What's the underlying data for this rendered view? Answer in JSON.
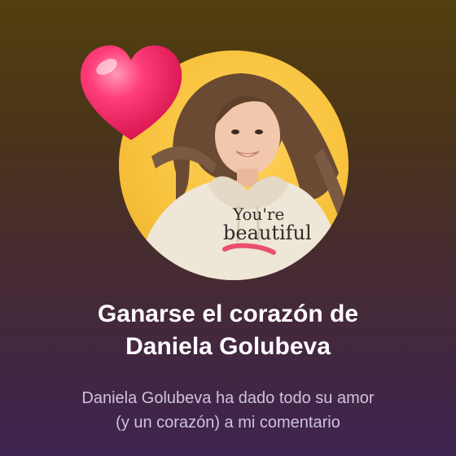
{
  "card": {
    "title_line1": "Ganarse el corazón de",
    "title_line2": "Daniela Golubeva",
    "subtitle_line1": "Daniela Golubeva ha dado todo su amor",
    "subtitle_line2": "(y un corazón) a mi comentario",
    "photo_text_line1": "You're",
    "photo_text_line2": "beautiful"
  },
  "icons": {
    "heart": "heart-icon"
  },
  "colors": {
    "background_top": "#52400f",
    "background_bottom": "#3f2350",
    "avatar_ring": "#f8c23c",
    "heart": "#ff2f6e",
    "title": "#ffffff",
    "subtitle": "#cfc3da"
  }
}
